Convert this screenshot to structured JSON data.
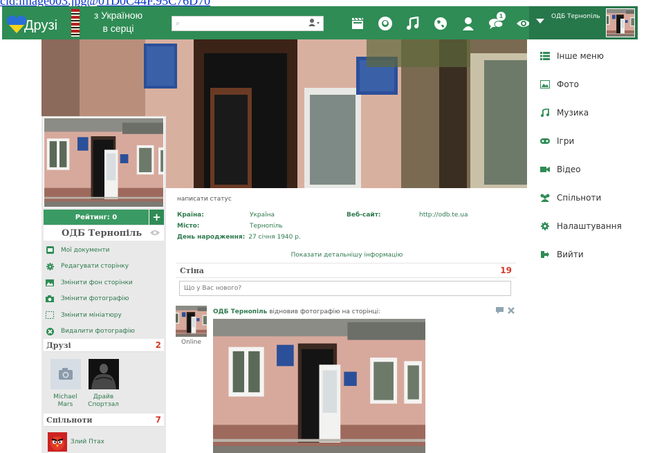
{
  "top_link": {
    "text": "cid:image003.jpg@01D0C44F.95C76D70"
  },
  "header": {
    "logo_text": "Друзі",
    "slogan_line1": "з Україною",
    "slogan_line2": "в серці",
    "search_placeholder": "",
    "nav_icons": [
      "video-icon",
      "face-icon",
      "music-icon",
      "globe-icon",
      "person-icon",
      "chat-icon",
      "eye-icon"
    ],
    "messages_badge": "1",
    "user_name": "ОДБ Тернопіль",
    "brand_color": "#2f8c55"
  },
  "right_menu": {
    "items": [
      {
        "label": "Інше меню",
        "icon": "list-icon"
      },
      {
        "label": "Фото",
        "icon": "image-icon"
      },
      {
        "label": "Музика",
        "icon": "music-icon"
      },
      {
        "label": "Ігри",
        "icon": "gamepad-icon"
      },
      {
        "label": "Відео",
        "icon": "video-camera-icon"
      },
      {
        "label": "Спільноти",
        "icon": "group-icon"
      },
      {
        "label": "Налаштування",
        "icon": "gear-icon"
      },
      {
        "label": "Вийти",
        "icon": "logout-icon"
      }
    ]
  },
  "profile": {
    "rating_label": "Рейтинг: 0",
    "add_label": "+",
    "name": "ОДБ Тернопіль",
    "actions": [
      {
        "label": "Мої документи",
        "icon": "documents-icon"
      },
      {
        "label": "Редагувати сторінку",
        "icon": "gear-icon"
      },
      {
        "label": "Змінити фон сторінки",
        "icon": "image-icon"
      },
      {
        "label": "Змінити фотографію",
        "icon": "camera-icon"
      },
      {
        "label": "Змінити мініатюру",
        "icon": "crop-icon"
      },
      {
        "label": "Видалити фотографію",
        "icon": "delete-icon"
      }
    ],
    "friends_title": "Друзі",
    "friends_count": "2",
    "friends": [
      {
        "first": "Michael",
        "last": "Mars"
      },
      {
        "first": "Драйв",
        "last": "Спортзал"
      }
    ],
    "communities_title": "Спільноти",
    "communities_count": "7",
    "communities": [
      {
        "name": "Злий Птах"
      }
    ]
  },
  "main": {
    "status_link": "написати статус",
    "info": {
      "country_label": "Країна:",
      "country": "Україна",
      "website_label": "Веб-сайт:",
      "website": "http://odb.te.ua",
      "city_label": "Місто:",
      "city": "Тернопіль",
      "birthday_label": "День народження:",
      "birthday": "27 січня 1940 р."
    },
    "show_more": "Показати детальнішу інформацію",
    "wall_title": "Стіна",
    "wall_count": "19",
    "new_post_placeholder": "Що у Вас нового?",
    "post": {
      "author": "ОДБ Тернопіль",
      "text": " відновив фотографію на сторінці:",
      "online": "Online"
    }
  }
}
